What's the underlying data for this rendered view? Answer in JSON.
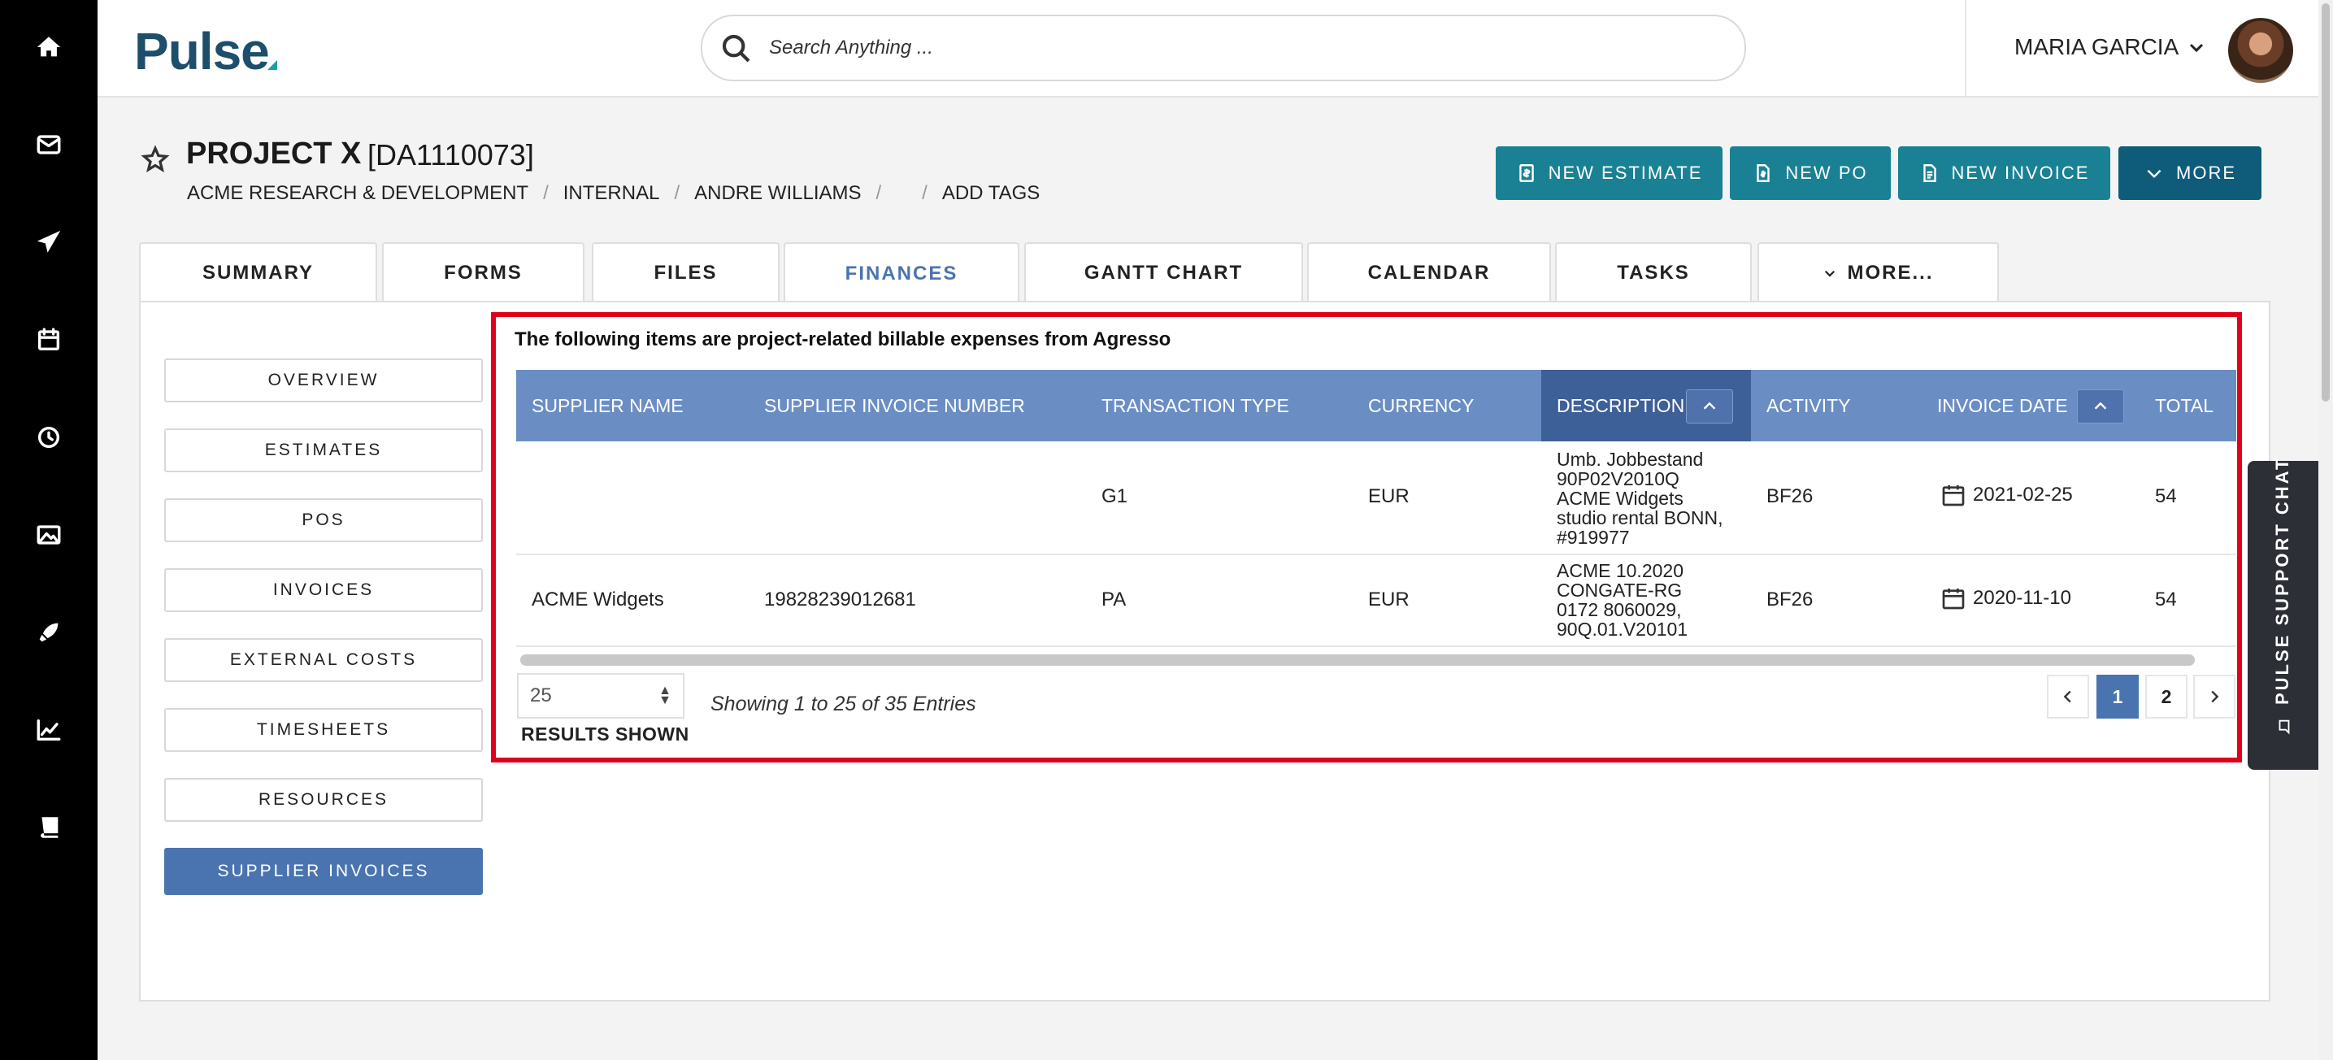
{
  "rail": {
    "icons": [
      "home-icon",
      "mail-icon",
      "send-icon",
      "calendar-icon",
      "clock-icon",
      "image-icon",
      "rocket-icon",
      "chart-line-icon",
      "book-icon"
    ]
  },
  "topbar": {
    "logo": "Pulse",
    "search_placeholder": "Search Anything ...",
    "user_name": "MARIA GARCIA"
  },
  "project": {
    "title": "PROJECT X",
    "code": "[DA1110073]",
    "breadcrumb": [
      "ACME RESEARCH & DEVELOPMENT",
      "INTERNAL",
      "ANDRE WILLIAMS",
      "",
      "ADD TAGS"
    ]
  },
  "actions": {
    "new_estimate": "NEW ESTIMATE",
    "new_po": "NEW PO",
    "new_invoice": "NEW INVOICE",
    "more": "MORE"
  },
  "tabs": [
    "SUMMARY",
    "FORMS",
    "FILES",
    "FINANCES",
    "GANTT CHART",
    "CALENDAR",
    "TASKS",
    "MORE..."
  ],
  "active_tab": "FINANCES",
  "side_nav": [
    "OVERVIEW",
    "ESTIMATES",
    "POS",
    "INVOICES",
    "EXTERNAL COSTS",
    "TIMESHEETS",
    "RESOURCES",
    "SUPPLIER INVOICES"
  ],
  "active_side": "SUPPLIER INVOICES",
  "table": {
    "note": "The following items are project-related billable expenses from Agresso",
    "columns": [
      "SUPPLIER NAME",
      "SUPPLIER INVOICE NUMBER",
      "TRANSACTION TYPE",
      "CURRENCY",
      "DESCRIPTION",
      "ACTIVITY",
      "INVOICE DATE",
      "TOTAL"
    ],
    "rows": [
      {
        "supplier_name": "",
        "invoice_number": "",
        "transaction_type": "G1",
        "currency": "EUR",
        "description": "Umb. Jobbestand 90P02V2010Q ACME Widgets studio rental BONN, #919977",
        "description_lines": [
          "Umb. Jobbestand",
          "90P02V2010Q",
          "ACME Widgets",
          "studio rental BONN,",
          "#919977"
        ],
        "activity": "BF26",
        "invoice_date": "2021-02-25",
        "total": "54"
      },
      {
        "supplier_name": "ACME Widgets",
        "invoice_number": "19828239012681",
        "transaction_type": "PA",
        "currency": "EUR",
        "description": "ACME 10.2020 CONGATE-RG 0172 8060029, 90Q.01.V20101",
        "description_lines": [
          "ACME 10.2020",
          "CONGATE-RG",
          "0172 8060029,",
          "90Q.01.V20101"
        ],
        "activity": "BF26",
        "invoice_date": "2020-11-10",
        "total": "54"
      }
    ],
    "page_size": "25",
    "results_shown_label": "RESULTS SHOWN",
    "entries_text": "Showing 1 to 25 of 35 Entries",
    "pages": [
      "1",
      "2"
    ],
    "current_page": "1"
  },
  "support_chat": "PULSE SUPPORT CHAT",
  "colors": {
    "accent_teal": "#1a8194",
    "accent_dark_teal": "#0f5c7a",
    "table_header": "#6a8ec4",
    "active_blue": "#4a74b0",
    "highlight_red": "#e0001b"
  }
}
